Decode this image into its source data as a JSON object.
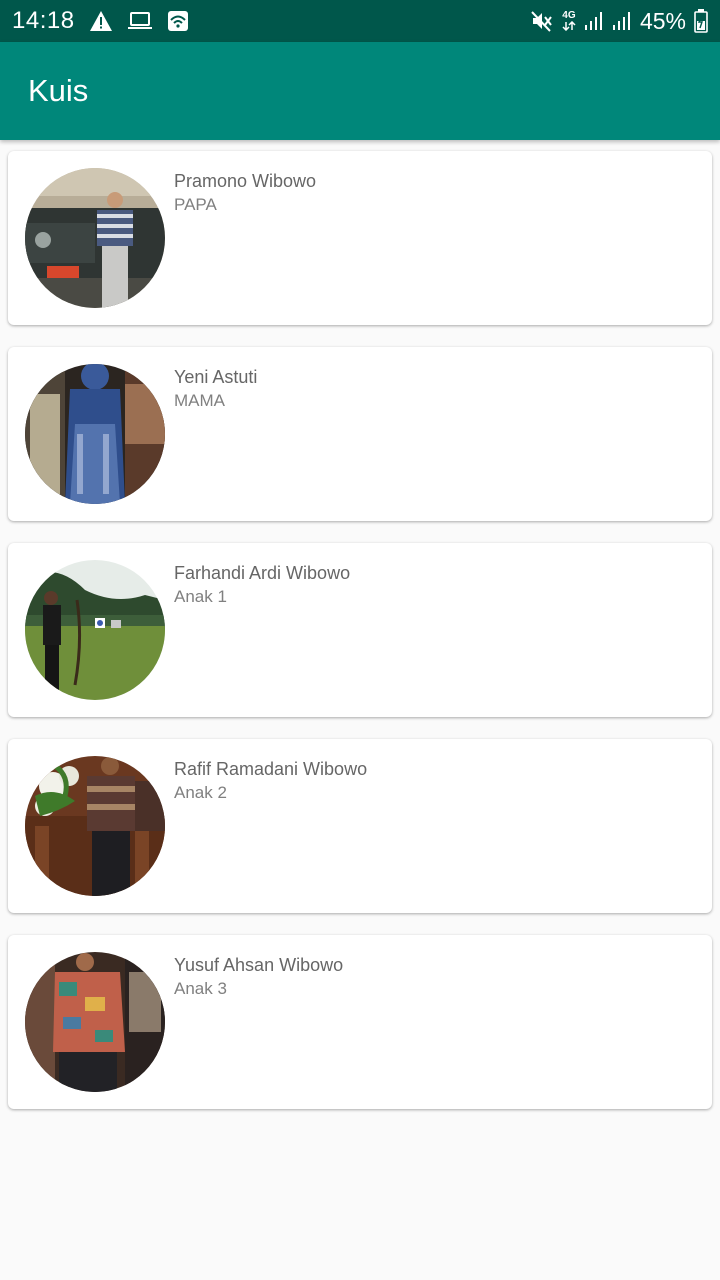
{
  "status_bar": {
    "time": "14:18",
    "network_type": "4G",
    "battery_percent": "45%",
    "left_icons": [
      "warning-icon",
      "laptop-icon",
      "wifi-icon"
    ],
    "right_icons": [
      "mute-icon",
      "network-4g-icon",
      "signal-icon",
      "signal-icon",
      "battery-icon"
    ]
  },
  "app_bar": {
    "title": "Kuis",
    "color": "#00877a"
  },
  "members": [
    {
      "name": "Pramono Wibowo",
      "role": "PAPA"
    },
    {
      "name": "Yeni Astuti",
      "role": "MAMA"
    },
    {
      "name": "Farhandi Ardi Wibowo",
      "role": "Anak 1"
    },
    {
      "name": "Rafif Ramadani Wibowo",
      "role": "Anak 2"
    },
    {
      "name": "Yusuf Ahsan Wibowo",
      "role": "Anak 3"
    }
  ]
}
